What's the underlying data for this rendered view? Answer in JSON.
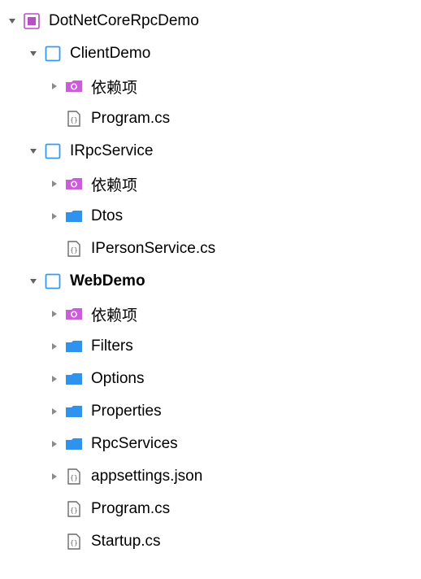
{
  "tree": {
    "solution": {
      "label": "DotNetCoreRpcDemo"
    },
    "clientDemo": {
      "label": "ClientDemo",
      "deps": "依赖项",
      "program": "Program.cs"
    },
    "iRpcService": {
      "label": "IRpcService",
      "deps": "依赖项",
      "dtos": "Dtos",
      "ipService": "IPersonService.cs"
    },
    "webDemo": {
      "label": "WebDemo",
      "deps": "依赖项",
      "filters": "Filters",
      "options": "Options",
      "properties": "Properties",
      "rpcServices": "RpcServices",
      "appsettings": "appsettings.json",
      "program": "Program.cs",
      "startup": "Startup.cs"
    }
  }
}
